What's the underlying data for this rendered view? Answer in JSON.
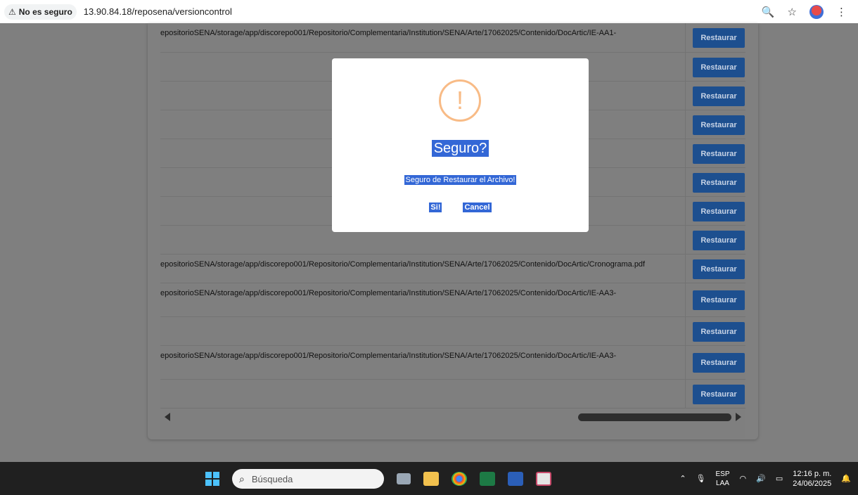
{
  "browser": {
    "security_label": "No es seguro",
    "url": "13.90.84.18/reposena/versioncontrol"
  },
  "table": {
    "rows": [
      {
        "path": "epositorioSENA/storage/app/discorepo001/Repositorio/Complementaria/Institution/SENA/Arte/17062025/Contenido/DocArtic/IE-AA1-",
        "button": "Restaurar"
      },
      {
        "path": "",
        "button": "Restaurar"
      },
      {
        "path": "",
        "button": "Restaurar"
      },
      {
        "path": "",
        "button": "Restaurar"
      },
      {
        "path": "",
        "button": "Restaurar"
      },
      {
        "path": "",
        "button": "Restaurar"
      },
      {
        "path": "",
        "button": "Restaurar"
      },
      {
        "path": "",
        "button": "Restaurar"
      },
      {
        "path": "epositorioSENA/storage/app/discorepo001/Repositorio/Complementaria/Institution/SENA/Arte/17062025/Contenido/DocArtic/Cronograma.pdf",
        "button": "Restaurar"
      },
      {
        "path": "epositorioSENA/storage/app/discorepo001/Repositorio/Complementaria/Institution/SENA/Arte/17062025/Contenido/DocArtic/IE-AA3-",
        "button": "Restaurar"
      },
      {
        "path": "",
        "button": "Restaurar"
      },
      {
        "path": "epositorioSENA/storage/app/discorepo001/Repositorio/Complementaria/Institution/SENA/Arte/17062025/Contenido/DocArtic/IE-AA3-",
        "button": "Restaurar"
      },
      {
        "path": "",
        "button": "Restaurar"
      }
    ]
  },
  "modal": {
    "icon": "!",
    "title": "Seguro?",
    "text": "Seguro de Restaurar el Archivo!",
    "confirm": "Si!",
    "cancel": "Cancel"
  },
  "taskbar": {
    "search_placeholder": "Búsqueda",
    "lang_top": "ESP",
    "lang_bottom": "LAA",
    "time": "12:16 p. m.",
    "date": "24/06/2025"
  }
}
